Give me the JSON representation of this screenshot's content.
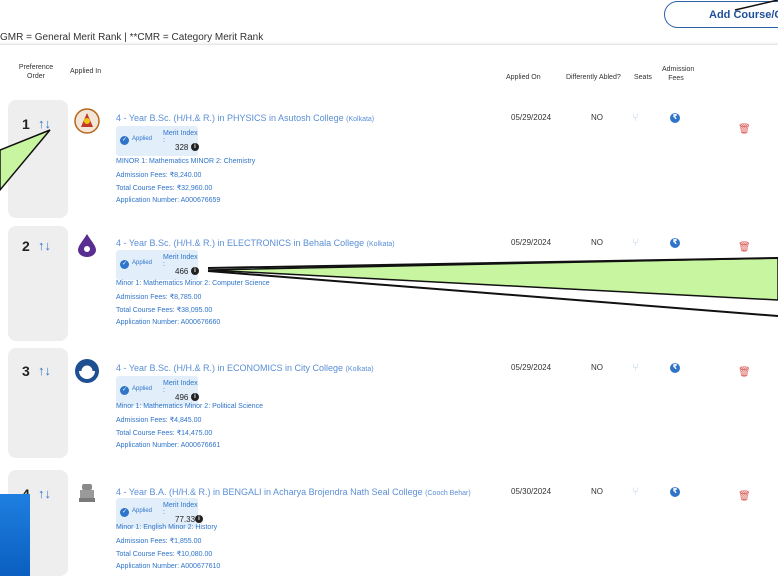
{
  "header": {
    "add_button_label": "Add Course/College",
    "legend": "GMR = General Merit Rank | **CMR = Category Merit Rank"
  },
  "table": {
    "columns": {
      "preference_order": "Preference Order",
      "applied_in": "Applied In",
      "applied_on": "Applied On",
      "differently_abled": "Differently Abled?",
      "seats": "Seats",
      "admission_fees": "Admission Fees"
    },
    "rows": [
      {
        "rank": "1",
        "title": "4 - Year B.Sc. (H/H.& R.) in PHYSICS in Asutosh College",
        "location": "(Kolkata)",
        "status": "Applied",
        "merit_label": "Merit Index :",
        "merit_value": "328",
        "minor": "MINOR 1: Mathematics MINOR 2: Chemistry",
        "admission_fees_label": "Admission Fees:",
        "admission_fees": "₹8,240.00",
        "total_fees_label": "Total Course Fees:",
        "total_fees": "₹32,960.00",
        "app_no_label": "Application Number:",
        "app_no": "A000676659",
        "applied_on": "05/29/2024",
        "differently_abled": "NO"
      },
      {
        "rank": "2",
        "title": "4 - Year B.Sc. (H/H.& R.) in ELECTRONICS in Behala College",
        "location": "(Kolkata)",
        "status": "Applied",
        "merit_label": "Merit Index :",
        "merit_value": "466",
        "minor": "Minor 1: Mathematics Minor 2: Computer Science",
        "admission_fees_label": "Admission Fees:",
        "admission_fees": "₹8,785.00",
        "total_fees_label": "Total Course Fees:",
        "total_fees": "₹38,095.00",
        "app_no_label": "Application Number:",
        "app_no": "A000676660",
        "applied_on": "05/29/2024",
        "differently_abled": "NO"
      },
      {
        "rank": "3",
        "title": "4 - Year B.Sc. (H/H.& R.) in ECONOMICS in City College",
        "location": "(Kolkata)",
        "status": "Applied",
        "merit_label": "Merit Index :",
        "merit_value": "496",
        "minor": "Minor 1: Mathematics Minor 2: Political Science",
        "admission_fees_label": "Admission Fees:",
        "admission_fees": "₹4,845.00",
        "total_fees_label": "Total Course Fees:",
        "total_fees": "₹14,475.00",
        "app_no_label": "Application Number:",
        "app_no": "A000676661",
        "applied_on": "05/29/2024",
        "differently_abled": "NO"
      },
      {
        "rank": "4",
        "title": "4 - Year B.A. (H/H.& R.) in BENGALI in Acharya Brojendra Nath Seal College",
        "location": "(Cooch Behar)",
        "status": "Applied",
        "merit_label": "Merit Index :",
        "merit_value": "77.33",
        "minor": "Minor 1: English Minor 2: History",
        "admission_fees_label": "Admission Fees:",
        "admission_fees": "₹1,855.00",
        "total_fees_label": "Total Course Fees:",
        "total_fees": "₹10,080.00",
        "app_no_label": "Application Number:",
        "app_no": "A000677610",
        "applied_on": "05/30/2024",
        "differently_abled": "NO"
      }
    ]
  },
  "icons": {
    "sort": "↑↓",
    "seat": "chair-icon",
    "fee": "rupee-icon",
    "delete": "trash-icon",
    "info": "info-icon"
  },
  "colors": {
    "accent": "#2f74c9",
    "link": "#5b8fd6",
    "danger": "#d9534f",
    "callout": "#c8f5a0"
  }
}
